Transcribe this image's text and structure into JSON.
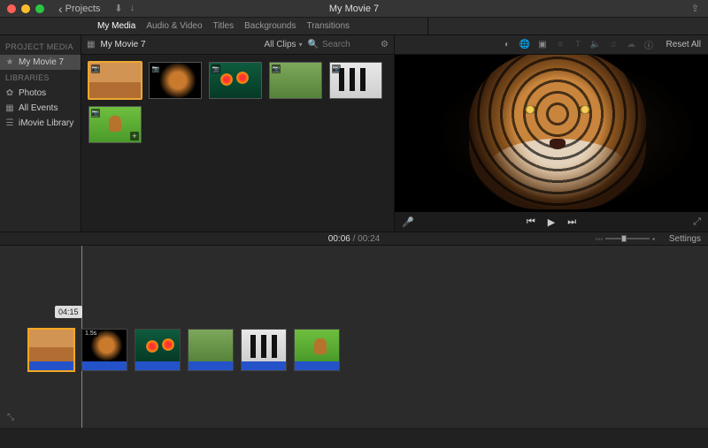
{
  "window": {
    "traffic": {
      "close": "#ff5f57",
      "min": "#febc2e",
      "max": "#28c840"
    },
    "back_label": "Projects",
    "title": "My Movie 7"
  },
  "tabs": {
    "items": [
      "My Media",
      "Audio & Video",
      "Titles",
      "Backgrounds",
      "Transitions"
    ],
    "active_index": 0,
    "reset_label": "Reset All"
  },
  "sidebar": {
    "sections": [
      {
        "heading": "PROJECT MEDIA",
        "items": [
          {
            "icon": "star",
            "label": "My Movie 7",
            "selected": true
          }
        ]
      },
      {
        "heading": "LIBRARIES",
        "items": [
          {
            "icon": "photos",
            "label": "Photos",
            "selected": false
          },
          {
            "icon": "calendar",
            "label": "All Events",
            "selected": false
          },
          {
            "icon": "library",
            "label": "iMovie Library",
            "selected": false
          }
        ]
      }
    ]
  },
  "browser": {
    "title": "My Movie 7",
    "filter_label": "All Clips",
    "search_placeholder": "Search",
    "thumbs": [
      {
        "name": "elephants",
        "selected": true,
        "badge": "camera"
      },
      {
        "name": "tiger",
        "selected": false,
        "badge": "camera"
      },
      {
        "name": "birds",
        "selected": false,
        "badge": "camera"
      },
      {
        "name": "leopard",
        "selected": false,
        "badge": "camera"
      },
      {
        "name": "penguins",
        "selected": false,
        "badge": "camera"
      },
      {
        "name": "deer",
        "selected": false,
        "badge": "camera",
        "add": true
      }
    ]
  },
  "viewer": {
    "icons": [
      "balance",
      "globe",
      "crop",
      "sliders",
      "text",
      "audio",
      "eq",
      "fx",
      "info"
    ],
    "dimmed": [
      3,
      4,
      5,
      6,
      7
    ]
  },
  "transport": {
    "mic": "microphone",
    "prev": "⏮",
    "play": "▶",
    "next": "⏭",
    "expand": "⤢"
  },
  "time": {
    "current": "00:06",
    "total": "00:24",
    "settings_label": "Settings"
  },
  "timeline": {
    "marker_label": "04:15",
    "clips": [
      {
        "name": "elephants",
        "selected": true,
        "dur": ""
      },
      {
        "name": "tiger",
        "selected": false,
        "dur": "1.5s"
      },
      {
        "name": "birds",
        "selected": false,
        "dur": ""
      },
      {
        "name": "leopard",
        "selected": false,
        "dur": ""
      },
      {
        "name": "penguins",
        "selected": false,
        "dur": ""
      },
      {
        "name": "deer",
        "selected": false,
        "dur": ""
      }
    ]
  }
}
